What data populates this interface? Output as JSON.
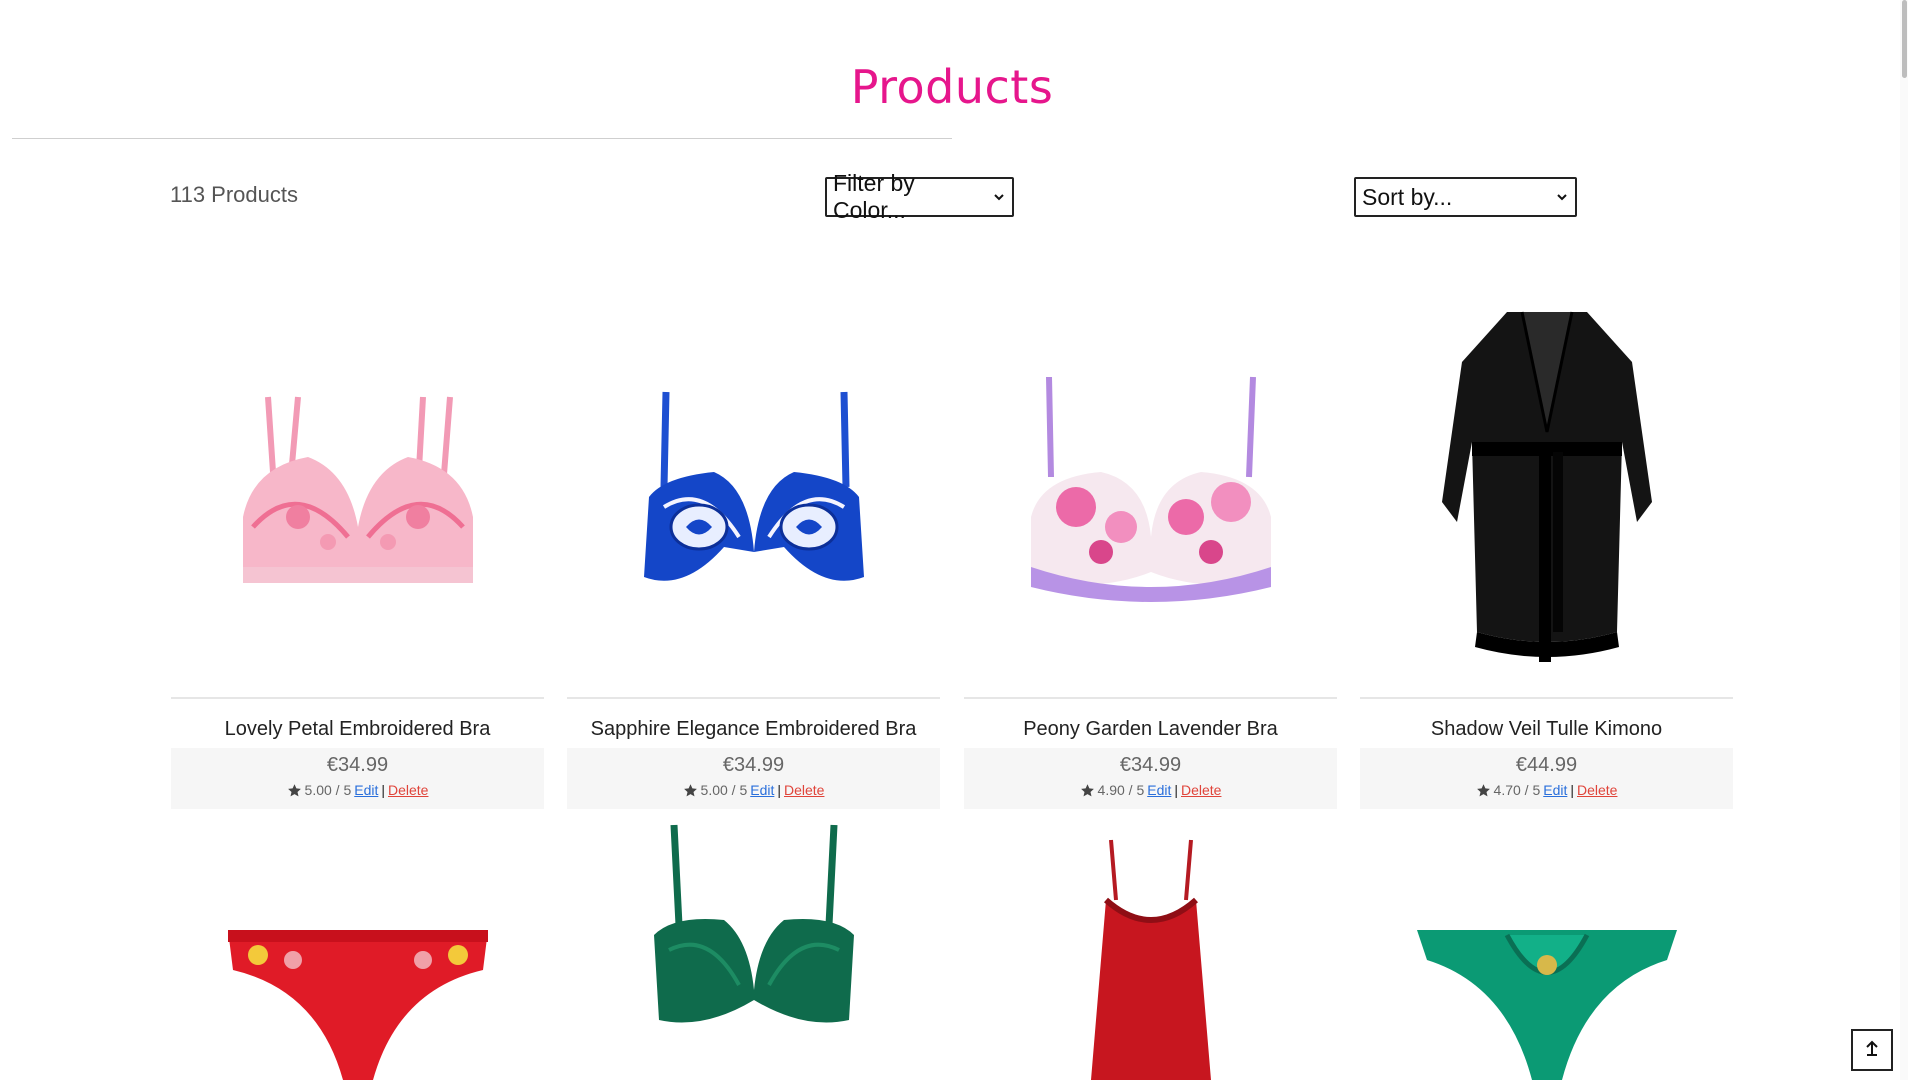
{
  "header": {
    "title": "Products"
  },
  "toolbar": {
    "count_label": "113 Products",
    "filter": {
      "selected": "Filter by Color..."
    },
    "sort": {
      "selected": "Sort by..."
    }
  },
  "products": [
    {
      "name": "Lovely Petal Embroidered Bra",
      "price": "€34.99",
      "rating": "5.00 / 5",
      "edit": "Edit",
      "delete": "Delete"
    },
    {
      "name": "Sapphire Elegance Embroidered Bra",
      "price": "€34.99",
      "rating": "5.00 / 5",
      "edit": "Edit",
      "delete": "Delete"
    },
    {
      "name": "Peony Garden Lavender Bra",
      "price": "€34.99",
      "rating": "4.90 / 5",
      "edit": "Edit",
      "delete": "Delete"
    },
    {
      "name": "Shadow Veil Tulle Kimono",
      "price": "€44.99",
      "rating": "4.70 / 5",
      "edit": "Edit",
      "delete": "Delete"
    }
  ],
  "colors": {
    "accent": "#e6168c",
    "edit_link": "#2a6fdb",
    "delete_link": "#e0443a"
  },
  "icons": {
    "star": "star-icon",
    "chevron": "chevron-down-icon",
    "scroll_top": "arrow-up-icon"
  }
}
